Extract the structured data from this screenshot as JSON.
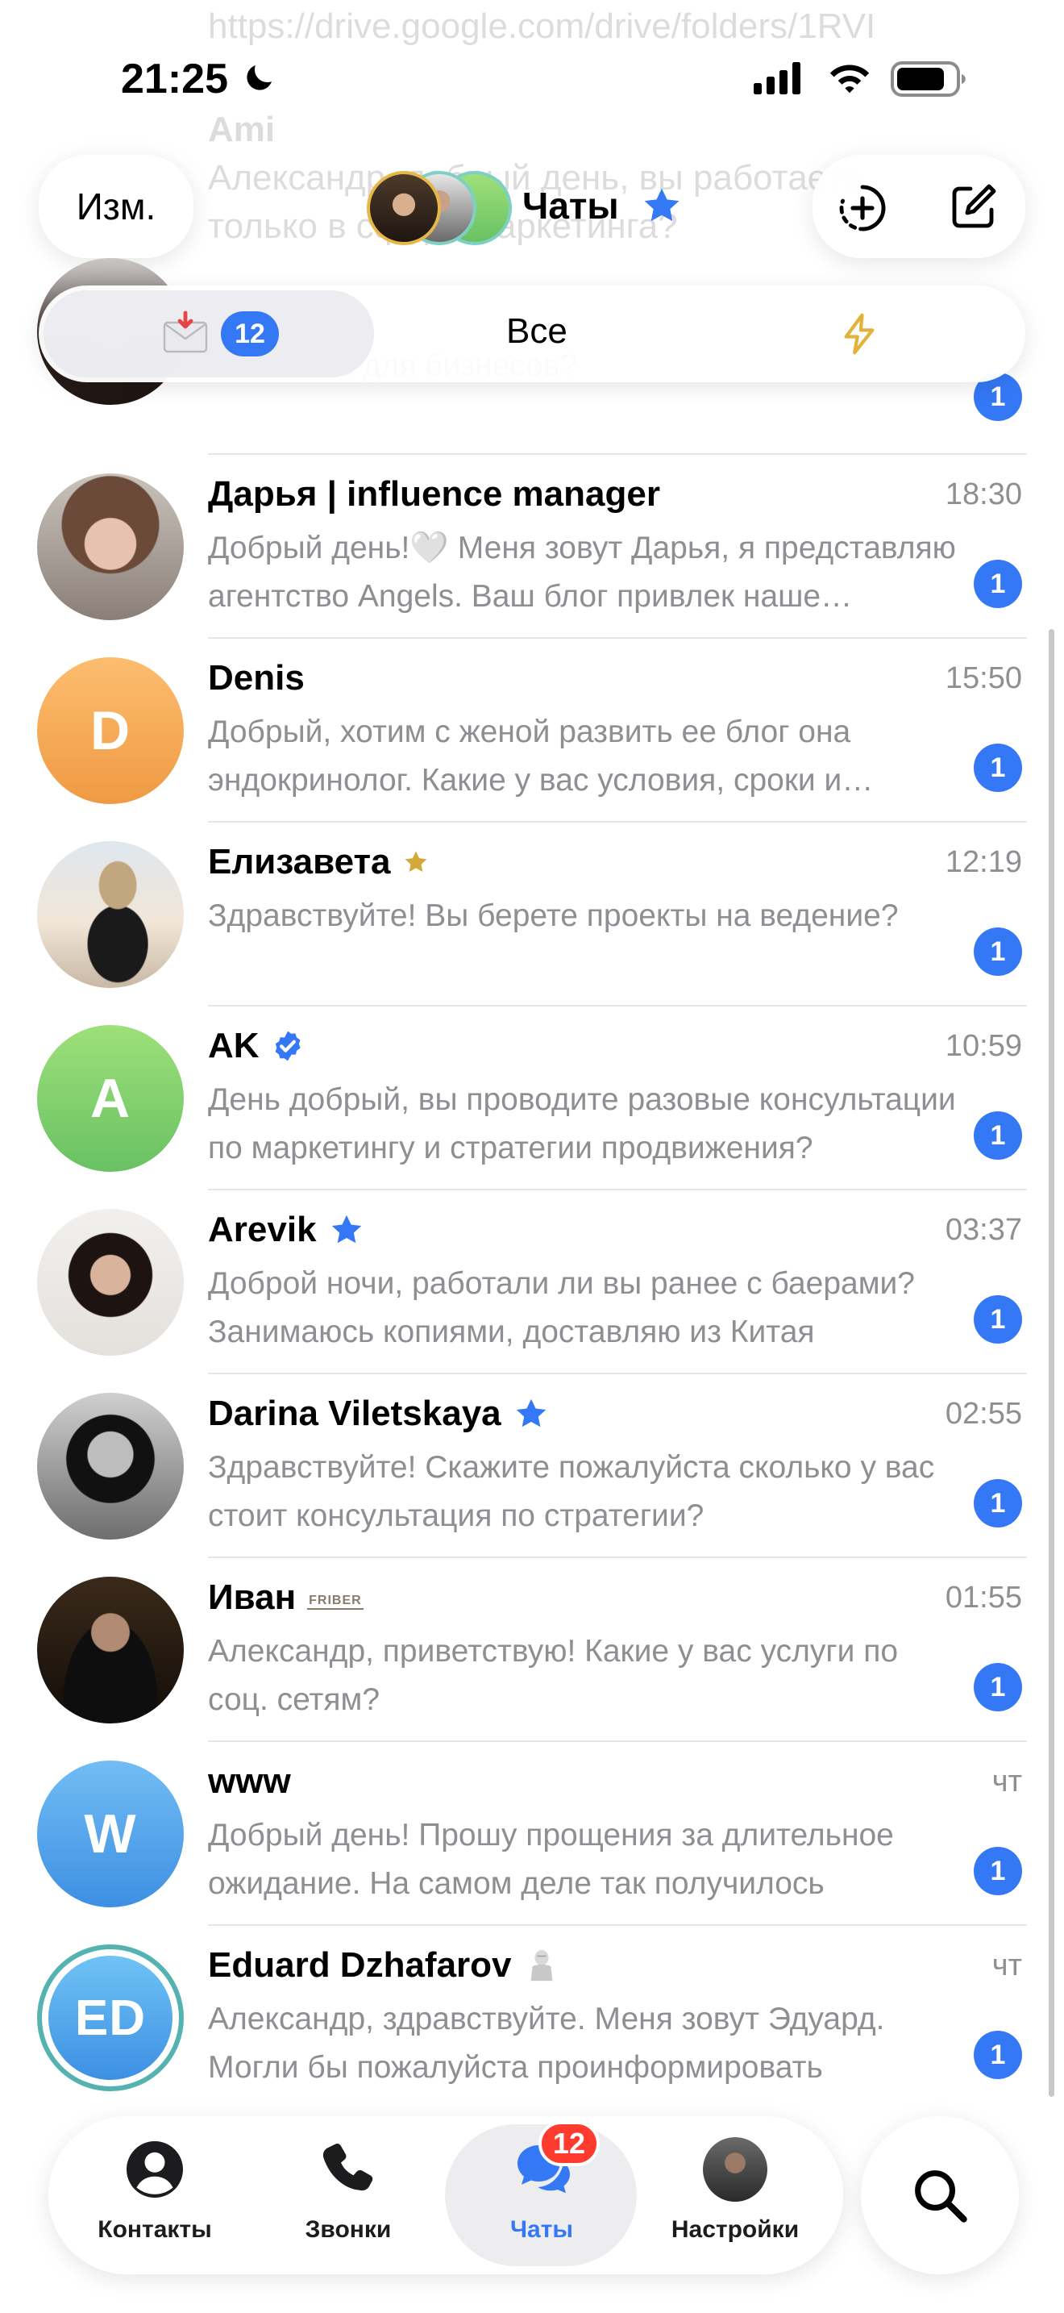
{
  "status_bar": {
    "time": "21:25"
  },
  "background_chats": {
    "line1": "https://drive.google.com/drive/folders/1RVI",
    "name2": "Ami",
    "line2": "Александр, добрый день, вы работаете",
    "line3": "только в сфере маркетинга?"
  },
  "header": {
    "edit_label": "Изм.",
    "title": "Чаты",
    "filters": [
      {
        "label": "",
        "count": "12",
        "icon": "envelope-icon"
      },
      {
        "label": "Все"
      },
      {
        "label": "",
        "icon": "bolt-icon"
      }
    ]
  },
  "top_partial_chat": {
    "preview": "Здравствуйте! Какие фотосессии работаете с вами есть для бизнесов?",
    "unread": "1"
  },
  "chats": [
    {
      "name": "Дарья | influence manager",
      "time": "18:30",
      "preview": "Добрый день!🤍 Меня зовут Дарья, я представляю агентство Angels. Ваш блог привлек наше внимание",
      "unread": "1"
    },
    {
      "name": "Denis",
      "time": "15:50",
      "preview": "Добрый, хотим с женой развить ее блог она эндокринолог. Какие у вас условия, сроки и стоимость?",
      "unread": "1",
      "initials": "D"
    },
    {
      "name": "Елизавета",
      "time": "12:19",
      "preview": "Здравствуйте! Вы берете проекты на ведение?",
      "unread": "1"
    },
    {
      "name": "AK",
      "time": "10:59",
      "preview": "День добрый, вы проводите разовые консультации по маркетингу и стратегии продвижения?",
      "unread": "1",
      "initials": "A"
    },
    {
      "name": "Arevik",
      "time": "03:37",
      "preview": "Доброй ночи, работали ли вы ранее с баерами? Занимаюсь копиями, доставляю из Китая",
      "unread": "1"
    },
    {
      "name": "Darina Viletskaya",
      "time": "02:55",
      "preview": "Здравствуйте! Скажите пожалуйста сколько у вас стоит консультация по стратегии?",
      "unread": "1"
    },
    {
      "name": "Иван",
      "time": "01:55",
      "preview": "Александр, приветствую! Какие у вас услуги по соц. сетям?",
      "unread": "1",
      "name_badge": "FRIBER"
    },
    {
      "name": "www",
      "time": "чт",
      "preview": "Добрый день! Прошу прощения за длительное ожидание. На самом деле так получилось",
      "unread": "1",
      "initials": "W"
    },
    {
      "name": "Eduard Dzhafarov",
      "time": "чт",
      "preview": "Александр, здравствуйте. Меня зовут Эдуард. Могли бы пожалуйста проинформировать",
      "unread": "1",
      "initials": "ED"
    }
  ],
  "tabbar": {
    "tabs": [
      {
        "label": "Контакты",
        "icon": "person-circle-icon"
      },
      {
        "label": "Звонки",
        "icon": "phone-icon"
      },
      {
        "label": "Чаты",
        "icon": "chat-bubbles-icon",
        "active": true
      },
      {
        "label": "Настройки",
        "icon": "profile-avatar"
      }
    ],
    "chats_badge": "12"
  },
  "colors": {
    "accent": "#3478f6",
    "badge_red": "#ff3b30",
    "secondary_text": "#8e8e93",
    "premium_star": "#3478f6",
    "gold_star": "#d4a93a"
  }
}
